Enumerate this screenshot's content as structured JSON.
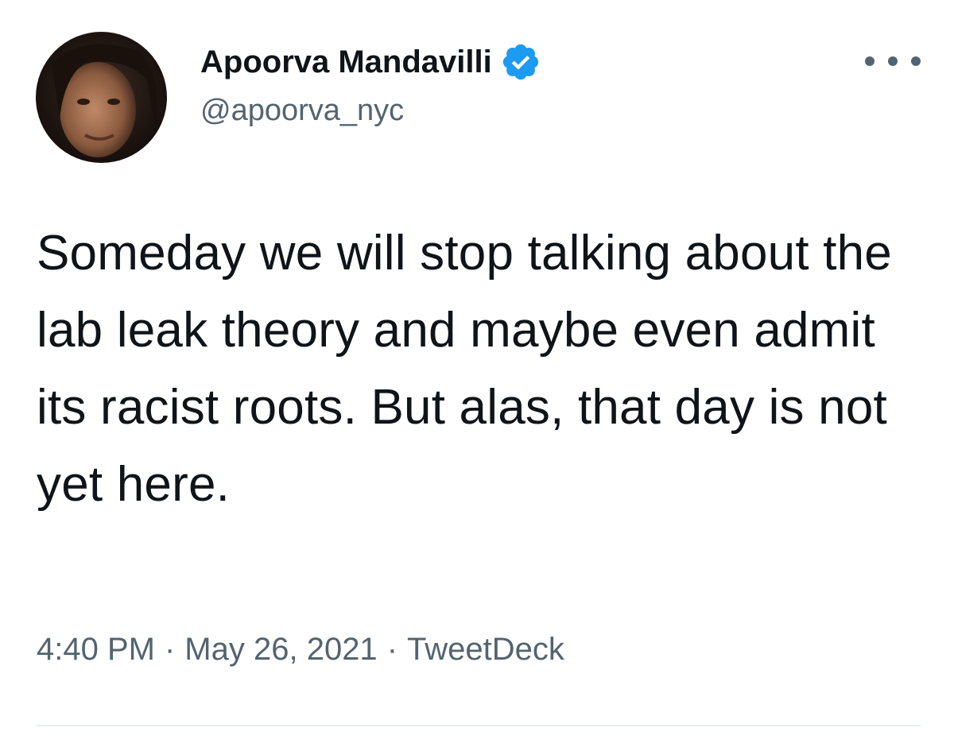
{
  "author": {
    "display_name": "Apoorva Mandavilli",
    "handle": "@apoorva_nyc",
    "verified": true,
    "avatar_icon": "profile-photo"
  },
  "menu_icon": "more-options-icon",
  "tweet": {
    "text": "Someday we will stop talking about the lab leak theory and maybe even admit its racist roots. But alas, that day is not yet here.",
    "time": "4:40 PM",
    "separator": "·",
    "date": "May 26, 2021",
    "source": "TweetDeck"
  },
  "colors": {
    "text": "#0f1419",
    "secondary_text": "#536471",
    "verified_badge": "#1d9bf0",
    "divider": "#e6ecf0"
  }
}
